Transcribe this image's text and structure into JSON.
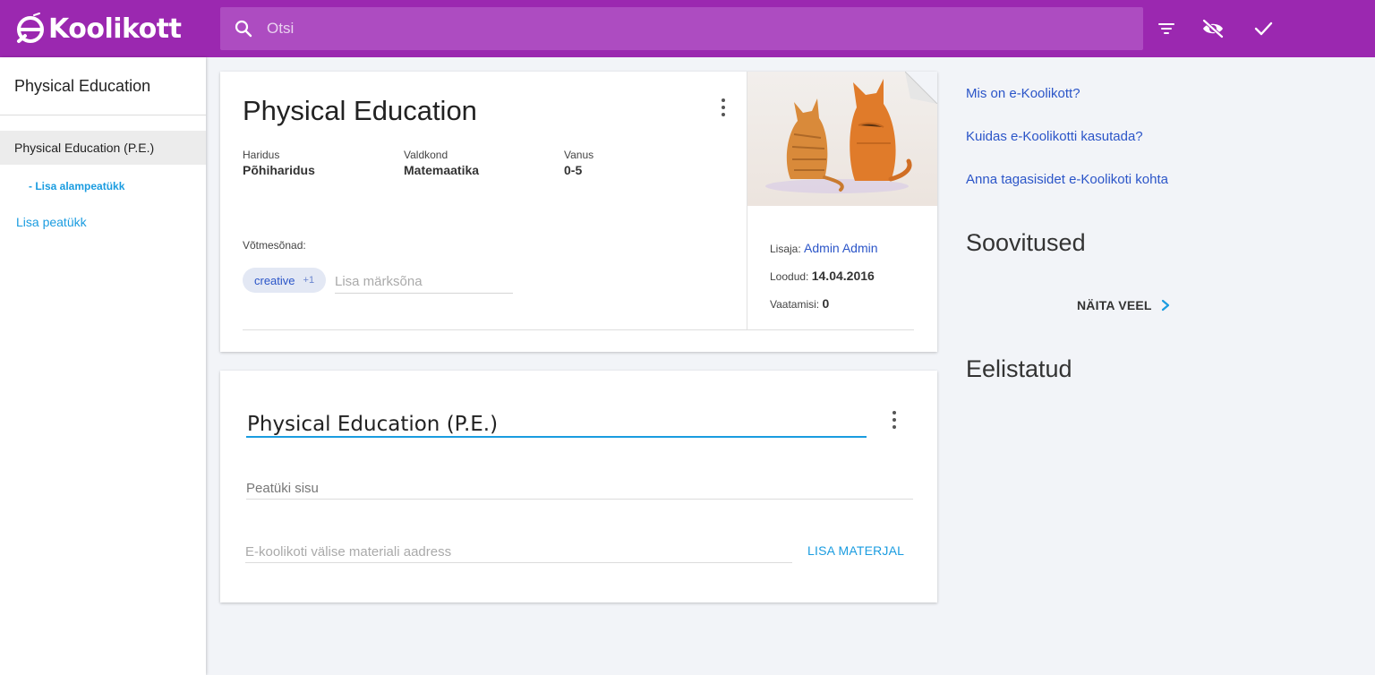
{
  "brand": {
    "logo_text": "Koolikott"
  },
  "search": {
    "placeholder": "Otsi"
  },
  "topbar": {
    "icons": [
      "filter-icon",
      "visibility-off-icon",
      "check-icon"
    ]
  },
  "sidebar": {
    "title": "Physical Education",
    "active_item": "Physical Education (P.E.)",
    "add_subchapter": "- Lisa alampeatükk",
    "add_chapter": "Lisa peatükk"
  },
  "material": {
    "title": "Physical Education",
    "meta": [
      {
        "label": "Haridus",
        "value": "Põhiharidus"
      },
      {
        "label": "Valdkond",
        "value": "Matemaatika"
      },
      {
        "label": "Vanus",
        "value": "0-5"
      }
    ],
    "keywords_label": "Võtmesõnad:",
    "keyword_chip": "creative",
    "keyword_extra": "+1",
    "keyword_placeholder": "Lisa märksõna",
    "info": {
      "author_label": "Lisaja:",
      "author": "Admin Admin",
      "created_label": "Loodud:",
      "created": "14.04.2016",
      "views_label": "Vaatamisi:",
      "views": "0"
    }
  },
  "chapter": {
    "title_value": "Physical Education (P.E.)",
    "content_placeholder": "Peatüki sisu",
    "url_placeholder": "E-koolikoti välise materiali aadress",
    "add_material": "LISA MATERJAL"
  },
  "right": {
    "links": [
      "Mis on e-Koolikott?",
      "Kuidas e-Koolikotti kasutada?",
      "Anna tagasisidet e-Koolikoti kohta"
    ],
    "recommendations_title": "Soovitused",
    "show_more": "NÄITA VEEL",
    "favorites_title": "Eelistatud"
  },
  "colors": {
    "brand": "#9b28b0",
    "accent": "#1a9ce0",
    "link": "#2b55c8"
  }
}
